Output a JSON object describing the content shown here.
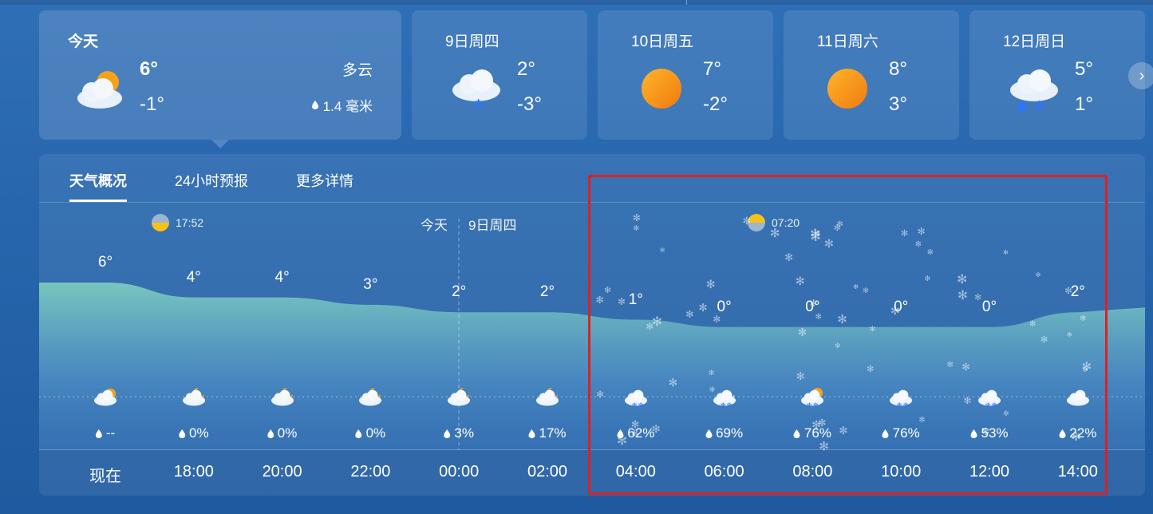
{
  "today": {
    "title": "今天",
    "high": "6°",
    "low": "-1°",
    "condition": "多云",
    "rain": "1.4 毫米",
    "icon": "partly-cloudy-icon"
  },
  "days": [
    {
      "title": "9日周四",
      "high": "2°",
      "low": "-3°",
      "icon": "snow-cloud-icon"
    },
    {
      "title": "10日周五",
      "high": "7°",
      "low": "-2°",
      "icon": "sun-icon"
    },
    {
      "title": "11日周六",
      "high": "8°",
      "low": "3°",
      "icon": "sun-icon"
    },
    {
      "title": "12日周日",
      "high": "5°",
      "low": "1°",
      "icon": "sleet-cloud-icon"
    }
  ],
  "next_icon": "chevron-right-icon",
  "tabs": [
    "天气概况",
    "24小时预报",
    "更多详情"
  ],
  "sun_events": [
    {
      "time": "17:52",
      "type": "sunset"
    },
    {
      "time": "07:20",
      "type": "sunrise"
    }
  ],
  "date_markers": {
    "today": "今天",
    "next": "9日周四"
  },
  "hourly": [
    {
      "time": "现在",
      "temp": 6,
      "temp_label": "6°",
      "precip": "--",
      "icon": "partly-cloudy-icon"
    },
    {
      "time": "18:00",
      "temp": 4,
      "temp_label": "4°",
      "precip": "0%",
      "icon": "cloudy-moon-icon"
    },
    {
      "time": "20:00",
      "temp": 4,
      "temp_label": "4°",
      "precip": "0%",
      "icon": "cloudy-moon-icon"
    },
    {
      "time": "22:00",
      "temp": 3,
      "temp_label": "3°",
      "precip": "0%",
      "icon": "cloudy-moon-icon"
    },
    {
      "time": "00:00",
      "temp": 2,
      "temp_label": "2°",
      "precip": "3%",
      "icon": "cloudy-moon-icon"
    },
    {
      "time": "02:00",
      "temp": 2,
      "temp_label": "2°",
      "precip": "17%",
      "icon": "cloudy-moon-icon"
    },
    {
      "time": "04:00",
      "temp": 1,
      "temp_label": "1°",
      "precip": "62%",
      "icon": "snow-cloud-icon"
    },
    {
      "time": "06:00",
      "temp": 0,
      "temp_label": "0°",
      "precip": "69%",
      "icon": "snow-cloud-icon"
    },
    {
      "time": "08:00",
      "temp": 0,
      "temp_label": "0°",
      "precip": "76%",
      "icon": "snow-sun-cloud-icon"
    },
    {
      "time": "10:00",
      "temp": 0,
      "temp_label": "0°",
      "precip": "76%",
      "icon": "snow-cloud-icon"
    },
    {
      "time": "12:00",
      "temp": 0,
      "temp_label": "0°",
      "precip": "53%",
      "icon": "snow-cloud-icon"
    },
    {
      "time": "14:00",
      "temp": 2,
      "temp_label": "2°",
      "precip": "22%",
      "icon": "cloudy-icon"
    }
  ],
  "colors": {
    "accent_highlight": "#e02020",
    "sun": "#f6a11a",
    "area_top": "#7fd0c0",
    "area_bottom": "#3b7cc0"
  }
}
